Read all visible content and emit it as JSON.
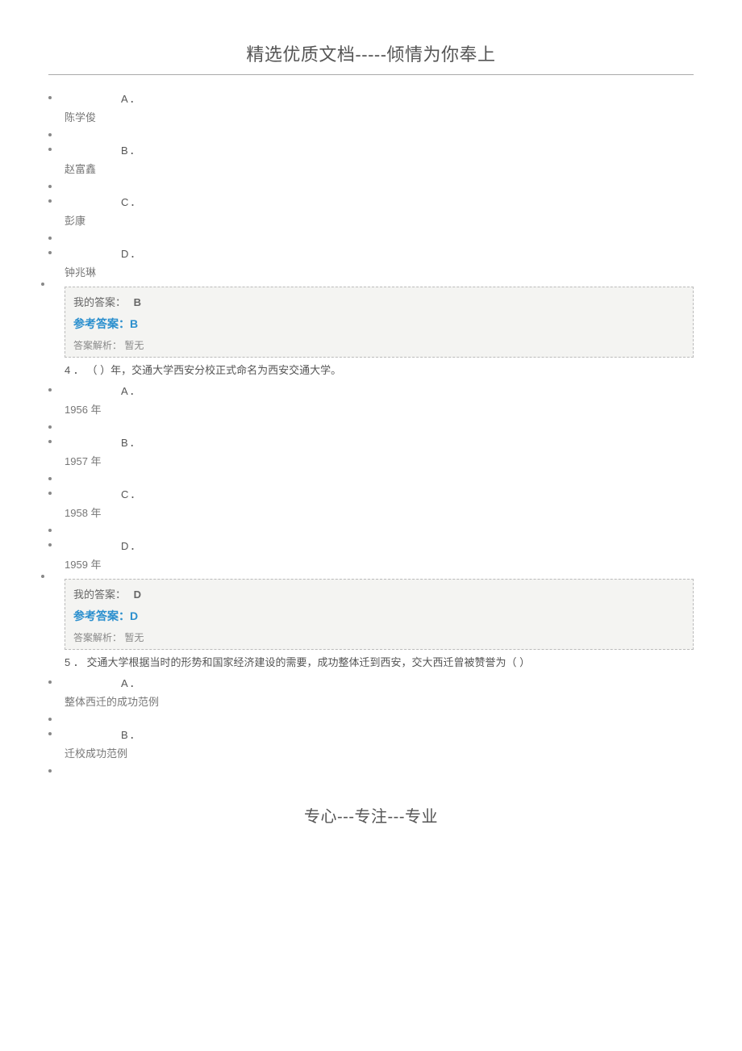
{
  "header": "精选优质文档-----倾情为你奉上",
  "footer": "专心---专注---专业",
  "q3": {
    "options": [
      {
        "letter": "A．",
        "text": "陈学俊"
      },
      {
        "letter": "B．",
        "text": "赵富鑫"
      },
      {
        "letter": "C．",
        "text": "彭康"
      },
      {
        "letter": "D．",
        "text": "钟兆琳"
      }
    ],
    "my_label": "我的答案：",
    "my_value": "B",
    "ref": "参考答案：B",
    "explain_label": "答案解析：",
    "explain_value": "暂无"
  },
  "q4": {
    "stem": "4 ． （ ）年，交通大学西安分校正式命名为西安交通大学。",
    "options": [
      {
        "letter": "A．",
        "text": "1956 年"
      },
      {
        "letter": "B．",
        "text": "1957 年"
      },
      {
        "letter": "C．",
        "text": "1958 年"
      },
      {
        "letter": "D．",
        "text": "1959 年"
      }
    ],
    "my_label": "我的答案：",
    "my_value": "D",
    "ref": "参考答案：D",
    "explain_label": "答案解析：",
    "explain_value": "暂无"
  },
  "q5": {
    "stem": "5 ． 交通大学根据当时的形势和国家经济建设的需要，成功整体迁到西安，交大西迁曾被赞誉为（ ）",
    "options": [
      {
        "letter": "A．",
        "text": "整体西迁的成功范例"
      },
      {
        "letter": "B．",
        "text": "迁校成功范例"
      }
    ]
  }
}
